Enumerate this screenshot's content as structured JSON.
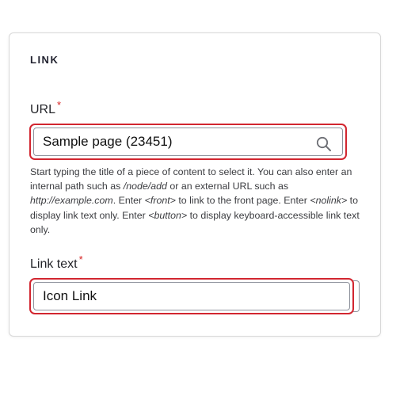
{
  "section": {
    "title": "LINK"
  },
  "url_field": {
    "label": "URL",
    "required_marker": "*",
    "value": "Sample page (23451)",
    "icon": "search-icon",
    "description": {
      "p1": "Start typing the title of a piece of content to select it. You can also enter an internal path such as ",
      "e1": "/node/add",
      "p2": " or an external URL such as ",
      "e2": "http://example.com",
      "p3": ". Enter ",
      "e3": "<front>",
      "p4": " to link to the front page. Enter ",
      "e4": "<nolink>",
      "p5": " to display link text only. Enter ",
      "e5": "<button>",
      "p6": " to display keyboard-accessible link text only."
    }
  },
  "link_text_field": {
    "label": "Link text",
    "required_marker": "*",
    "value": "Icon Link"
  },
  "colors": {
    "focus_outline": "#d22630",
    "required": "#d72222",
    "border": "#8e929c"
  }
}
